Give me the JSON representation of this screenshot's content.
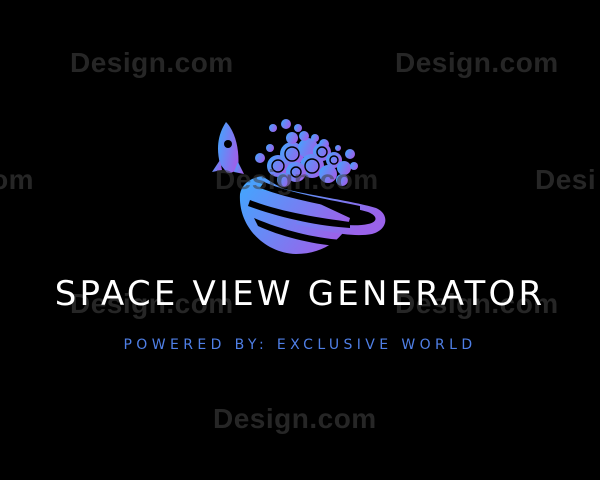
{
  "watermark": {
    "text": "Design.com",
    "partial_left": "com",
    "partial_right": "Desi",
    "color": "#262626"
  },
  "logo": {
    "icon": "rocket-planet-icon",
    "gradient_start": "#3ea9ff",
    "gradient_end": "#9a63ea"
  },
  "brand": {
    "title": "SPACE VIEW GENERATOR",
    "subtitle": "POWERED BY: EXCLUSIVE WORLD",
    "title_color": "#ffffff",
    "subtitle_color": "#4f7fe6"
  },
  "background": "#000000"
}
